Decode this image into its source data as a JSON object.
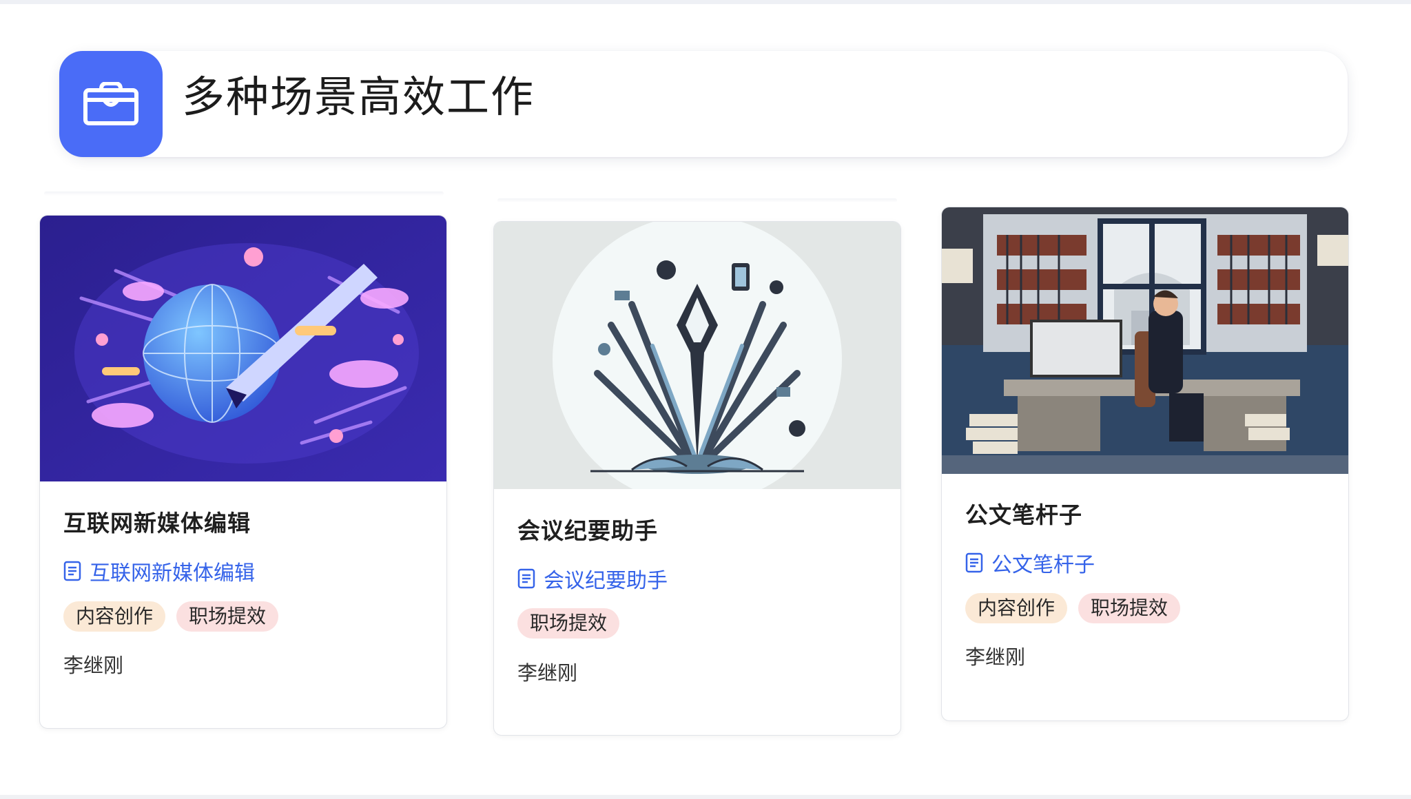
{
  "header": {
    "title": "多种场景高效工作",
    "icon": "briefcase-icon",
    "accent": "#4a6cf7"
  },
  "cards": [
    {
      "title": "互联网新媒体编辑",
      "link_label": "互联网新媒体编辑",
      "tags": [
        "内容创作",
        "职场提效"
      ],
      "author": "李继刚",
      "image": "digital-pen-globe-illustration"
    },
    {
      "title": "会议纪要助手",
      "link_label": "会议纪要助手",
      "tags": [
        "职场提效"
      ],
      "author": "李继刚",
      "image": "pen-nib-tools-illustration"
    },
    {
      "title": "公文笔杆子",
      "link_label": "公文笔杆子",
      "tags": [
        "内容创作",
        "职场提效"
      ],
      "author": "李继刚",
      "image": "office-writer-illustration"
    }
  ],
  "colors": {
    "link": "#3563e9",
    "tag_content": "#fbe9d6",
    "tag_efficiency": "#fbe0e0"
  }
}
